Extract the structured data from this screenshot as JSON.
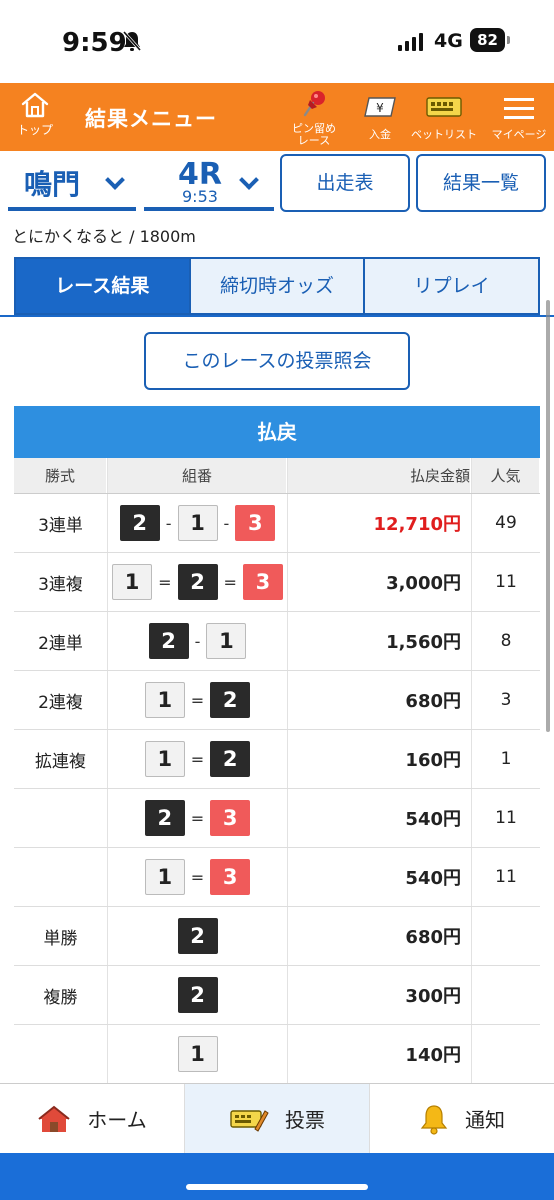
{
  "status_bar": {
    "time": "9:59",
    "network": "4G",
    "battery": "82"
  },
  "header": {
    "home_label": "トップ",
    "title": "結果メニュー",
    "pin_label_1": "ピン留め",
    "pin_label_2": "レース",
    "deposit_label": "入金",
    "bet_list_label": "ベットリスト",
    "mypage_label": "マイページ"
  },
  "selector": {
    "venue": "鳴門",
    "race_number": "4R",
    "race_time": "9:53",
    "entry_button": "出走表",
    "results_list_button": "結果一覧"
  },
  "race_info": "とにかくなると / 1800m",
  "tabs": [
    {
      "label": "レース結果"
    },
    {
      "label": "締切時オッズ"
    },
    {
      "label": "リプレイ"
    }
  ],
  "vote_inquiry_button": "このレースの投票照会",
  "payout": {
    "title": "払戻",
    "columns": {
      "bet_type": "勝式",
      "combo": "組番",
      "amount": "払戻金額",
      "popularity": "人気"
    },
    "rows": [
      {
        "bet_type": "3連単",
        "combo": [
          "2",
          "-",
          "1",
          "-",
          "3"
        ],
        "amount": "12,710円",
        "popularity": "49",
        "highlight": true
      },
      {
        "bet_type": "3連複",
        "combo": [
          "1",
          "=",
          "2",
          "=",
          "3"
        ],
        "amount": "3,000円",
        "popularity": "11"
      },
      {
        "bet_type": "2連単",
        "combo": [
          "2",
          "-",
          "1"
        ],
        "amount": "1,560円",
        "popularity": "8"
      },
      {
        "bet_type": "2連複",
        "combo": [
          "1",
          "=",
          "2"
        ],
        "amount": "680円",
        "popularity": "3"
      },
      {
        "bet_type": "拡連複",
        "combo": [
          "1",
          "=",
          "2"
        ],
        "amount": "160円",
        "popularity": "1"
      },
      {
        "bet_type": "",
        "combo": [
          "2",
          "=",
          "3"
        ],
        "amount": "540円",
        "popularity": "11"
      },
      {
        "bet_type": "",
        "combo": [
          "1",
          "=",
          "3"
        ],
        "amount": "540円",
        "popularity": "11"
      },
      {
        "bet_type": "単勝",
        "combo": [
          "2"
        ],
        "amount": "680円",
        "popularity": ""
      },
      {
        "bet_type": "複勝",
        "combo": [
          "2"
        ],
        "amount": "300円",
        "popularity": ""
      },
      {
        "bet_type": "",
        "combo": [
          "1"
        ],
        "amount": "140円",
        "popularity": ""
      }
    ]
  },
  "bottom_nav": [
    {
      "label": "ホーム",
      "icon": "house-icon"
    },
    {
      "label": "投票",
      "icon": "ticket-pen-icon"
    },
    {
      "label": "通知",
      "icon": "bell-icon"
    }
  ],
  "colors": {
    "header_orange": "#f58220",
    "primary_blue": "#1a5fb4",
    "payout_header_blue": "#2e8fe0",
    "boat_1": "#f2f2f2",
    "boat_2": "#2a2a2a",
    "boat_3": "#f05a5a",
    "highlight_red": "#e01e1e"
  }
}
